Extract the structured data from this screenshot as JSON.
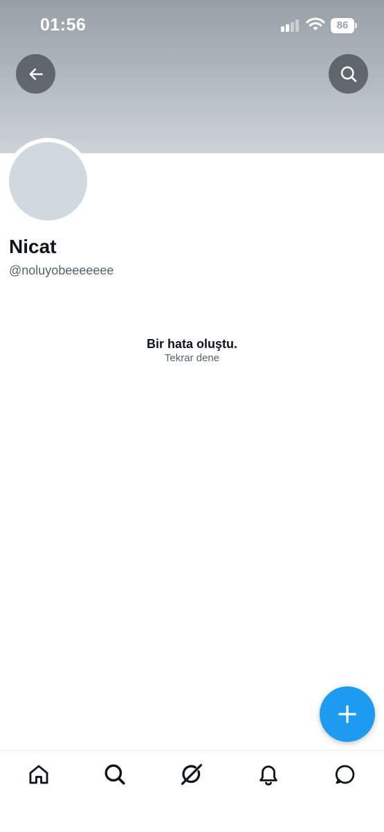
{
  "status_bar": {
    "time": "01:56",
    "battery_level": "86",
    "signal_bars_active": 2,
    "signal_bars_total": 4
  },
  "header": {
    "back_icon": "arrow-left-icon",
    "search_icon": "search-icon"
  },
  "profile": {
    "display_name": "Nicat",
    "handle": "@noluyobeeeeeee"
  },
  "error": {
    "title": "Bir hata oluştu.",
    "retry_label": "Tekrar dene"
  },
  "fab": {
    "icon": "plus-icon"
  },
  "tab_bar": {
    "items": [
      {
        "name": "home",
        "icon": "home-icon"
      },
      {
        "name": "search",
        "icon": "search-icon"
      },
      {
        "name": "grok",
        "icon": "grok-icon"
      },
      {
        "name": "notifications",
        "icon": "bell-icon"
      },
      {
        "name": "messages",
        "icon": "message-icon"
      }
    ]
  },
  "colors": {
    "accent": "#1d9bf0",
    "text_primary": "#0f1419",
    "text_secondary": "#536471",
    "avatar_placeholder": "#cfd9de"
  }
}
